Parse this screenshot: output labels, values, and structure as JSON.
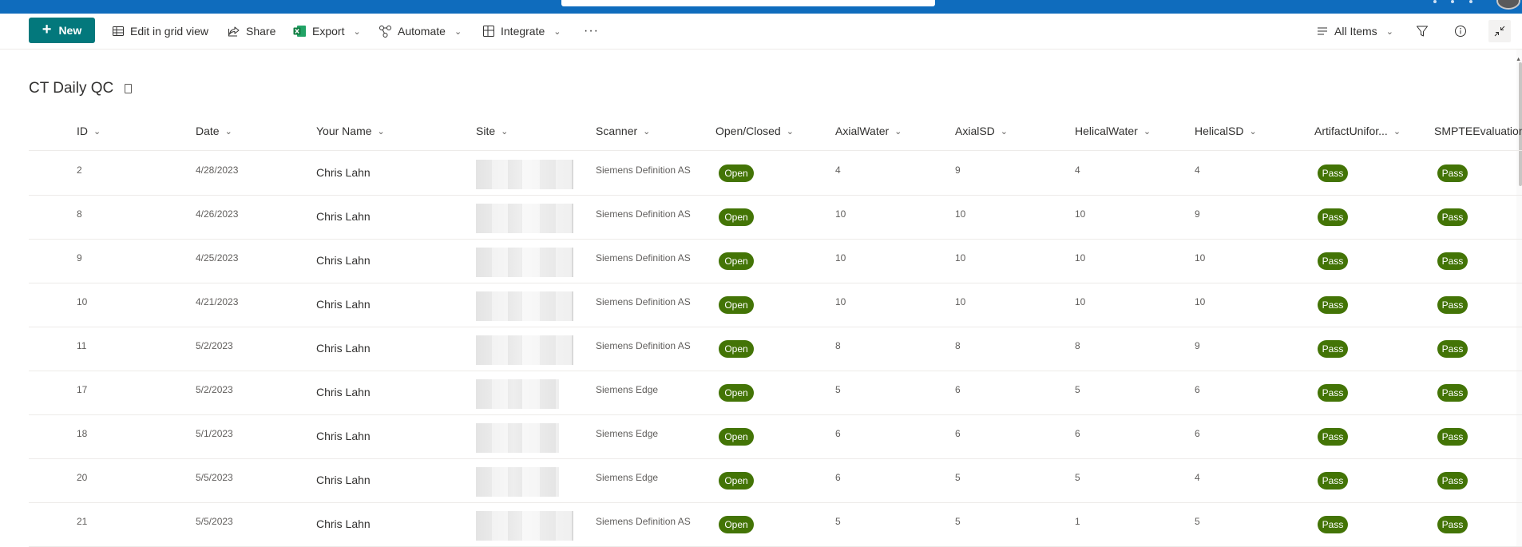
{
  "command_bar": {
    "new_label": "New",
    "edit_grid_label": "Edit in grid view",
    "share_label": "Share",
    "export_label": "Export",
    "automate_label": "Automate",
    "integrate_label": "Integrate",
    "more_label": "···",
    "view_label": "All Items"
  },
  "list": {
    "title": "CT Daily QC",
    "columns": [
      "ID",
      "Date",
      "Your Name",
      "Site",
      "Scanner",
      "Open/Closed",
      "AxialWater",
      "AxialSD",
      "HelicalWater",
      "HelicalSD",
      "ArtifactUnifor...",
      "SMPTEEvaluation"
    ],
    "rows": [
      {
        "id": "2",
        "date": "4/28/2023",
        "name": "Chris Lahn",
        "scanner": "Siemens Definition AS",
        "status": "Open",
        "axial_water": "4",
        "axial_sd": "9",
        "helical_water": "4",
        "helical_sd": "4",
        "artifact": "Pass",
        "smpte": "Pass"
      },
      {
        "id": "8",
        "date": "4/26/2023",
        "name": "Chris Lahn",
        "scanner": "Siemens Definition AS",
        "status": "Open",
        "axial_water": "10",
        "axial_sd": "10",
        "helical_water": "10",
        "helical_sd": "9",
        "artifact": "Pass",
        "smpte": "Pass"
      },
      {
        "id": "9",
        "date": "4/25/2023",
        "name": "Chris Lahn",
        "scanner": "Siemens Definition AS",
        "status": "Open",
        "axial_water": "10",
        "axial_sd": "10",
        "helical_water": "10",
        "helical_sd": "10",
        "artifact": "Pass",
        "smpte": "Pass"
      },
      {
        "id": "10",
        "date": "4/21/2023",
        "name": "Chris Lahn",
        "scanner": "Siemens Definition AS",
        "status": "Open",
        "axial_water": "10",
        "axial_sd": "10",
        "helical_water": "10",
        "helical_sd": "10",
        "artifact": "Pass",
        "smpte": "Pass"
      },
      {
        "id": "11",
        "date": "5/2/2023",
        "name": "Chris Lahn",
        "scanner": "Siemens Definition AS",
        "status": "Open",
        "axial_water": "8",
        "axial_sd": "8",
        "helical_water": "8",
        "helical_sd": "9",
        "artifact": "Pass",
        "smpte": "Pass"
      },
      {
        "id": "17",
        "date": "5/2/2023",
        "name": "Chris Lahn",
        "scanner": "Siemens Edge",
        "status": "Open",
        "axial_water": "5",
        "axial_sd": "6",
        "helical_water": "5",
        "helical_sd": "6",
        "artifact": "Pass",
        "smpte": "Pass"
      },
      {
        "id": "18",
        "date": "5/1/2023",
        "name": "Chris Lahn",
        "scanner": "Siemens Edge",
        "status": "Open",
        "axial_water": "6",
        "axial_sd": "6",
        "helical_water": "6",
        "helical_sd": "6",
        "artifact": "Pass",
        "smpte": "Pass"
      },
      {
        "id": "20",
        "date": "5/5/2023",
        "name": "Chris Lahn",
        "scanner": "Siemens Edge",
        "status": "Open",
        "axial_water": "6",
        "axial_sd": "5",
        "helical_water": "5",
        "helical_sd": "4",
        "artifact": "Pass",
        "smpte": "Pass"
      },
      {
        "id": "21",
        "date": "5/5/2023",
        "name": "Chris Lahn",
        "scanner": "Siemens Definition AS",
        "status": "Open",
        "axial_water": "5",
        "axial_sd": "5",
        "helical_water": "1",
        "helical_sd": "5",
        "artifact": "Pass",
        "smpte": "Pass"
      }
    ]
  },
  "colors": {
    "suite_bar": "#0f6cbd",
    "new_button": "#03787c",
    "pill_green": "#437406"
  },
  "icons": [
    "grid-icon",
    "share-icon",
    "excel-icon",
    "automate-icon",
    "integrate-icon",
    "list-view-icon",
    "filter-icon",
    "info-icon",
    "collapse-icon"
  ]
}
